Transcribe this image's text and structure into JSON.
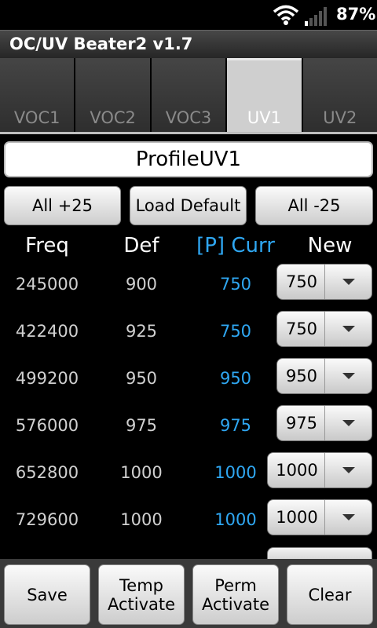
{
  "status": {
    "battery": "87%"
  },
  "app": {
    "title": "OC/UV Beater2 v1.7"
  },
  "tabs": [
    {
      "label": "VOC1"
    },
    {
      "label": "VOC2"
    },
    {
      "label": "VOC3"
    },
    {
      "label": "UV1",
      "active": true
    },
    {
      "label": "UV2"
    }
  ],
  "profile": {
    "value": "ProfileUV1"
  },
  "top_buttons": {
    "all_plus": "All +25",
    "load_default": "Load Default",
    "all_minus": "All -25"
  },
  "headers": {
    "freq": "Freq",
    "def": "Def",
    "curr": "[P] Curr",
    "new": "New"
  },
  "rows": [
    {
      "freq": "245000",
      "def": "900",
      "curr": "750",
      "new": "750"
    },
    {
      "freq": "422400",
      "def": "925",
      "curr": "750",
      "new": "750"
    },
    {
      "freq": "499200",
      "def": "950",
      "curr": "950",
      "new": "950"
    },
    {
      "freq": "576000",
      "def": "975",
      "curr": "975",
      "new": "975"
    },
    {
      "freq": "652800",
      "def": "1000",
      "curr": "1000",
      "new": "1000"
    },
    {
      "freq": "729600",
      "def": "1000",
      "curr": "1000",
      "new": "1000"
    }
  ],
  "bottom_buttons": {
    "save": "Save",
    "temp": "Temp\nActivate",
    "perm": "Perm\nActivate",
    "clear": "Clear"
  },
  "colors": {
    "accent": "#2fa7f2"
  }
}
